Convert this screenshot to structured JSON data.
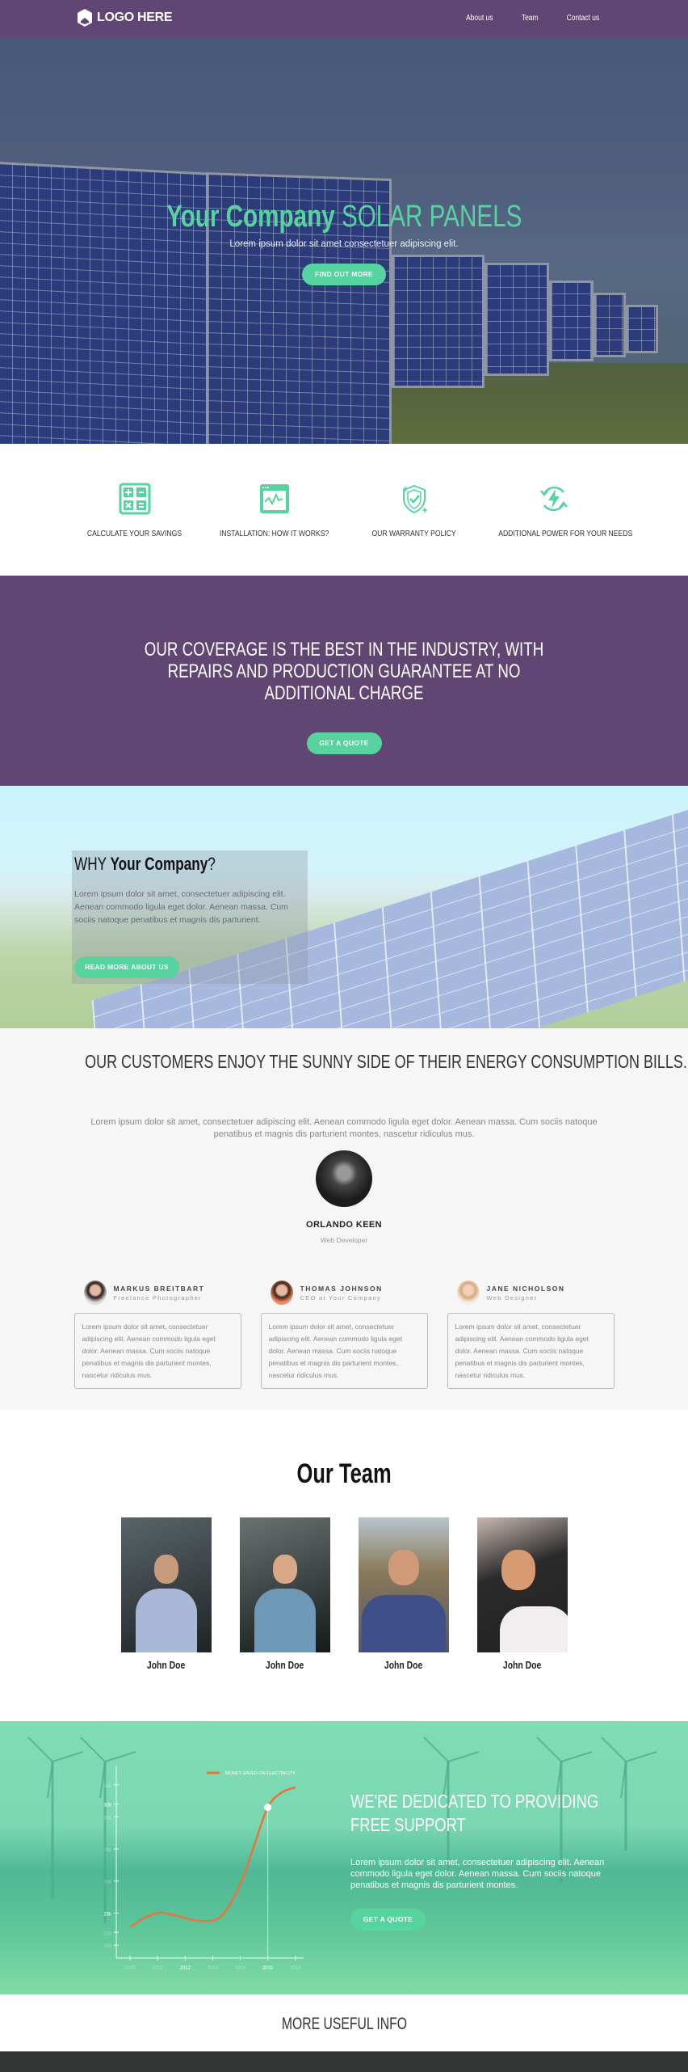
{
  "nav": {
    "logo_text": "LOGO HERE",
    "links": [
      "About us",
      "Team",
      "Contact us"
    ]
  },
  "hero": {
    "title_bold": "Your Company",
    "title_light": "SOLAR PANELS",
    "subtitle": "Lorem ipsum dolor sit amet consectetuer adipiscing elit.",
    "cta": "FIND OUT MORE"
  },
  "features": [
    {
      "icon": "calculator-icon",
      "label": "CALCULATE YOUR SAVINGS"
    },
    {
      "icon": "chart-window-icon",
      "label": "INSTALLATION: HOW IT WORKS?"
    },
    {
      "icon": "shield-check-icon",
      "label": "OUR WARRANTY POLICY"
    },
    {
      "icon": "power-cycle-icon",
      "label": "ADDITIONAL POWER FOR YOUR NEEDS"
    }
  ],
  "coverage": {
    "heading": "OUR COVERAGE IS THE BEST IN THE INDUSTRY, WITH REPAIRS AND PRODUCTION GUARANTEE AT NO ADDITIONAL CHARGE",
    "cta": "GET A QUOTE"
  },
  "why": {
    "heading_prefix": "WHY",
    "heading_bold": "Your Company",
    "heading_suffix": "?",
    "text": "Lorem ipsum dolor sit amet, consectetuer adipiscing elit. Aenean commodo ligula eget dolor. Aenean massa. Cum sociis natoque penatibus et magnis dis parturient.",
    "cta": "READ MORE ABOUT US"
  },
  "testimonials": {
    "heading": "OUR CUSTOMERS ENJOY THE SUNNY SIDE OF THEIR ENERGY CONSUMPTION BILLS.",
    "intro": "Lorem ipsum dolor sit amet, consectetuer adipiscing elit. Aenean commodo ligula eget dolor. Aenean massa. Cum sociis natoque penatibus et magnis dis parturient montes, nascetur ridiculus mus.",
    "featured": {
      "name": "ORLANDO KEEN",
      "role": "Web Developer"
    },
    "cards": [
      {
        "name": "MARKUS BREITBART",
        "role": "Freelance Photographer",
        "text": "Lorem ipsum dolor sit amet, consectetuer adipiscing elit. Aenean commodo ligula eget dolor. Aenean massa. Cum sociis natoque penatibus et magnis dis parturient montes, nascetur ridiculus mus."
      },
      {
        "name": "THOMAS JOHNSON",
        "role": "CEO at Your Company",
        "text": "Lorem ipsum dolor sit amet, consectetuer adipiscing elit. Aenean commodo ligula eget dolor. Aenean massa. Cum sociis natoque penatibus et magnis dis parturient montes, nascetur ridiculus mus."
      },
      {
        "name": "JANE NICHOLSON",
        "role": "Web Designer",
        "text": "Lorem ipsum dolor sit amet, consectetuer adipiscing elit. Aenean commodo ligula eget dolor. Aenean massa. Cum sociis natoque penatibus et magnis dis parturient montes, nascetur ridiculus mus."
      }
    ]
  },
  "team": {
    "heading": "Our Team",
    "members": [
      {
        "name": "John Doe"
      },
      {
        "name": "John Doe"
      },
      {
        "name": "John Doe"
      },
      {
        "name": "John Doe"
      }
    ]
  },
  "support": {
    "heading": "WE'RE DEDICATED TO PROVIDING FREE SUPPORT",
    "text": "Lorem ipsum dolor sit amet, consectetuer adipiscing elit. Aenean commodo ligula eget dolor. Aenean massa. Cum sociis natoque penatibus et magnis dis parturient montes.",
    "cta": "GET A QUOTE"
  },
  "chart_data": {
    "type": "line",
    "title": "",
    "legend": [
      "MONEY SAVED ON ELECTRICITY"
    ],
    "legend_position": "top-right",
    "x_ticks": [
      "2010",
      "2011",
      "2012",
      "2013",
      "2014",
      "2015",
      "2016"
    ],
    "y_ticks": [
      "10k",
      "12k",
      "15k",
      "20k",
      "25k",
      "30k",
      "32k",
      "35k"
    ],
    "series": [
      {
        "name": "MONEY SAVED ON ELECTRICITY",
        "x": [
          2010,
          2010.5,
          2011,
          2011.5,
          2012.5,
          2013.3,
          2014,
          2014.5,
          2015,
          2015.5,
          2016
        ],
        "y": [
          12.8,
          14.2,
          15.0,
          14.8,
          13.8,
          14.5,
          19.5,
          25.5,
          31.5,
          33.8,
          34.6
        ]
      }
    ],
    "highlight": {
      "x": 2015,
      "y": 31.5
    },
    "ylim": [
      8,
      38
    ],
    "xlim": [
      2009.5,
      2016.3
    ],
    "grid": false
  },
  "more": {
    "heading": "MORE USEFUL INFO"
  },
  "colors": {
    "brand_purple": "#614572",
    "accent_green": "#56d39f",
    "line_orange": "#e8743b"
  }
}
